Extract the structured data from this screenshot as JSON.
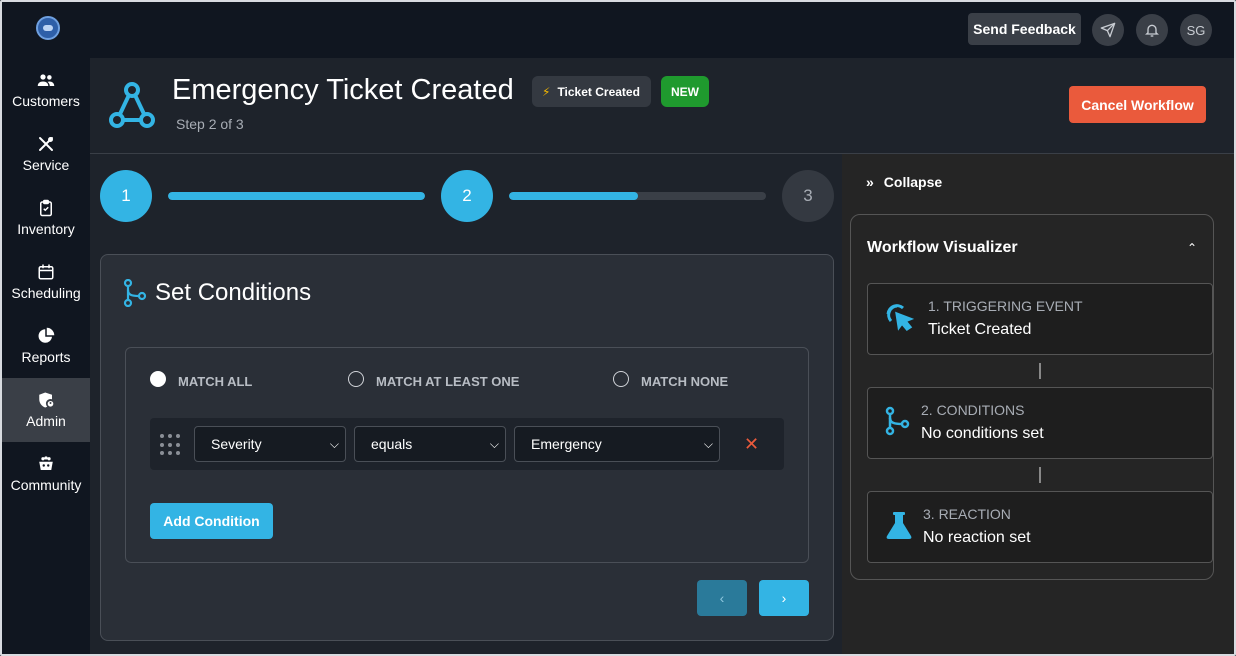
{
  "topbar": {
    "feedback_label": "Send Feedback",
    "avatar_initials": "SG"
  },
  "sidebar": {
    "items": [
      {
        "label": "Customers",
        "icon": "users-icon"
      },
      {
        "label": "Service",
        "icon": "tools-icon"
      },
      {
        "label": "Inventory",
        "icon": "clipboard-icon"
      },
      {
        "label": "Scheduling",
        "icon": "calendar-icon"
      },
      {
        "label": "Reports",
        "icon": "pie-chart-icon"
      },
      {
        "label": "Admin",
        "icon": "shield-user-icon",
        "active": true
      },
      {
        "label": "Community",
        "icon": "community-icon"
      }
    ]
  },
  "header": {
    "title": "Emergency Ticket Created",
    "trigger_badge": "Ticket Created",
    "new_badge": "NEW",
    "step_text": "Step 2 of 3",
    "cancel_label": "Cancel Workflow"
  },
  "stepper": {
    "steps": [
      "1",
      "2",
      "3"
    ],
    "current": 2,
    "progress": [
      1.0,
      0.5
    ]
  },
  "conditions": {
    "title": "Set Conditions",
    "match_options": [
      {
        "label": "MATCH ALL",
        "checked": true
      },
      {
        "label": "MATCH AT LEAST ONE",
        "checked": false
      },
      {
        "label": "MATCH NONE",
        "checked": false
      }
    ],
    "rows": [
      {
        "field": "Severity",
        "operator": "equals",
        "value": "Emergency"
      }
    ],
    "add_label": "Add Condition"
  },
  "visualizer": {
    "collapse_label": "Collapse",
    "title": "Workflow Visualizer",
    "steps": [
      {
        "label": "1. TRIGGERING EVENT",
        "value": "Ticket Created",
        "icon": "cursor-click-icon"
      },
      {
        "label": "2. CONDITIONS",
        "value": "No conditions set",
        "icon": "branch-icon"
      },
      {
        "label": "3. REACTION",
        "value": "No reaction set",
        "icon": "flask-icon"
      }
    ]
  },
  "colors": {
    "accent": "#33b4e4",
    "danger": "#ea5a3c",
    "success": "#1f9a2e",
    "bolt": "#f5b800"
  }
}
